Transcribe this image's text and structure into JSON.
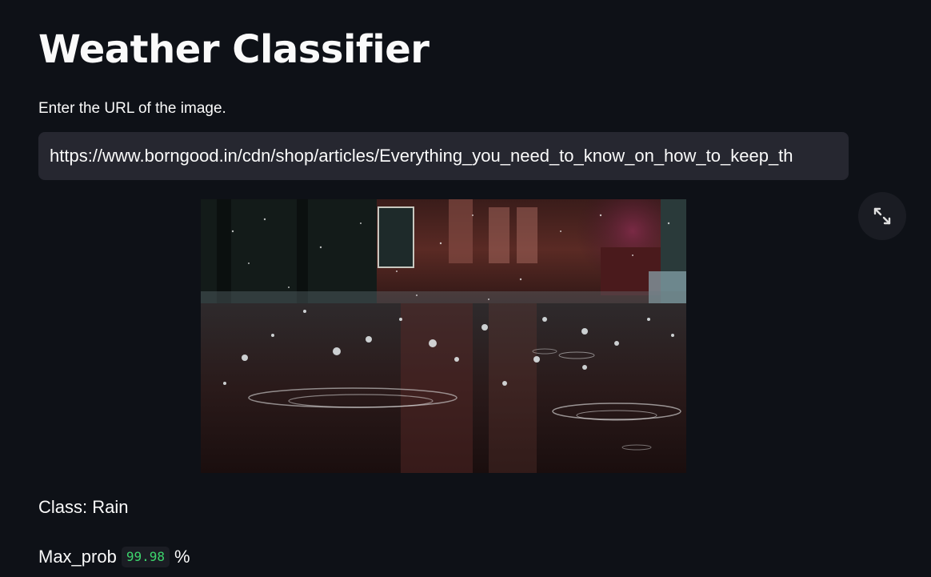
{
  "app": {
    "title": "Weather Classifier"
  },
  "input": {
    "label": "Enter the URL of the image.",
    "value": "https://www.borngood.in/cdn/shop/articles/Everything_you_need_to_know_on_how_to_keep_th"
  },
  "image": {
    "description_icon": "rain-puddle-photo",
    "fullscreen_icon": "expand-icon"
  },
  "result": {
    "class_text": "Class: Rain",
    "prob_label": "Max_prob",
    "prob_value": "99.98",
    "prob_unit": "%"
  },
  "colors": {
    "background": "#0e1117",
    "input_background": "#262730",
    "code_text": "#3dd56d",
    "text": "#fafafa"
  }
}
